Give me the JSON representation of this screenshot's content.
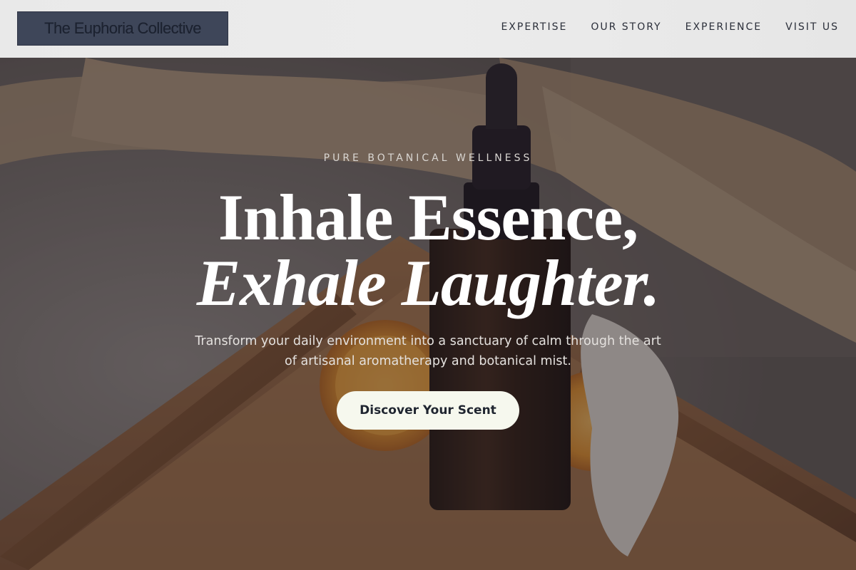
{
  "brand": {
    "name": "The Euphoria Collective"
  },
  "nav": {
    "items": [
      {
        "label": "EXPERTISE"
      },
      {
        "label": "OUR STORY"
      },
      {
        "label": "EXPERIENCE"
      },
      {
        "label": "VISIT US"
      }
    ]
  },
  "hero": {
    "eyebrow": "PURE BOTANICAL WELLNESS",
    "headline_line1": "Inhale Essence,",
    "headline_line2": "Exhale Laughter.",
    "subtitle": "Transform your daily environment into a sanctuary of calm through the art of artisanal aromatherapy and botanical mist.",
    "cta_label": "Discover Your Scent"
  },
  "colors": {
    "nav_bg": "#eaeaea",
    "brand_box": "#3e4659",
    "cta_bg": "#f6f8ee",
    "overlay": "#28222c"
  }
}
